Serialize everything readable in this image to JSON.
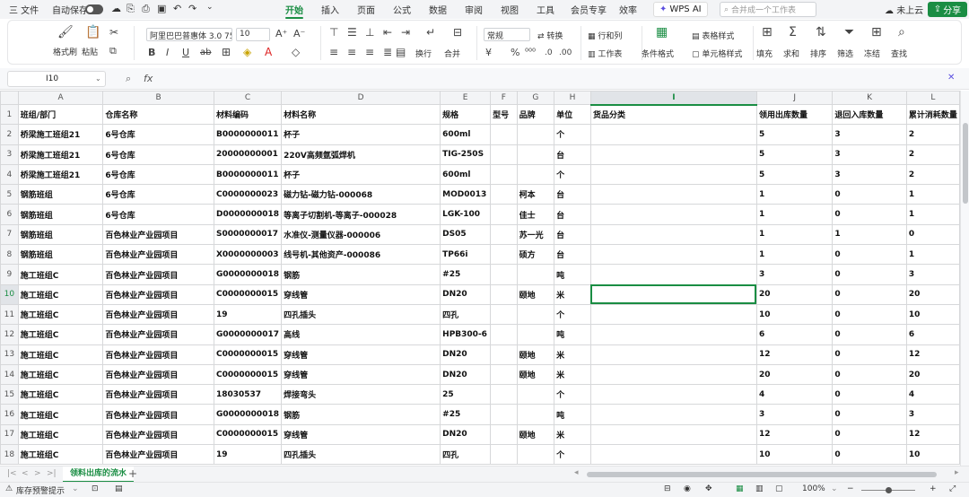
{
  "menubar": {
    "file_menu": "三 文件",
    "autosave_label": "自动保存",
    "tabs": [
      "开始",
      "插入",
      "页面",
      "公式",
      "数据",
      "审阅",
      "视图",
      "工具",
      "会员专享",
      "效率"
    ],
    "active_tab": "开始",
    "wps_ai": "WPS AI",
    "search_placeholder": "合并成一个工作表",
    "cloud_status": "未上云",
    "share_label": "分享"
  },
  "ribbon": {
    "format_painter": "格式刷",
    "paste": "粘贴",
    "font_name": "阿里巴巴普惠体 3.0 75",
    "font_size": "10",
    "wrap_text": "换行",
    "merge": "合并",
    "number_format": "常规",
    "convert": "转换",
    "rows_cols": "行和列",
    "worksheet": "工作表",
    "conditional_format": "条件格式",
    "table_style": "表格样式",
    "cell_style": "单元格样式",
    "fill": "填充",
    "sum": "求和",
    "sort": "排序",
    "filter": "筛选",
    "freeze": "冻结",
    "find": "查找"
  },
  "formula_bar": {
    "cell_ref": "I10",
    "fx": "fx",
    "content": ""
  },
  "columns": [
    "A",
    "B",
    "C",
    "D",
    "E",
    "F",
    "G",
    "H",
    "I",
    "J",
    "K",
    "L"
  ],
  "selected_column": "I",
  "selected_row": "10",
  "rows": [
    {
      "n": "1",
      "cells": [
        "班组/部门",
        "仓库名称",
        "材料编码",
        "材料名称",
        "规格",
        "型号",
        "品牌",
        "单位",
        "货品分类",
        "领用出库数量",
        "退回入库数量",
        "累计消耗数量"
      ]
    },
    {
      "n": "2",
      "cells": [
        "桥梁施工班组21",
        "6号仓库",
        "B0000000011",
        "杯子",
        "600ml",
        "",
        "",
        "个",
        "",
        "5",
        "3",
        "2"
      ]
    },
    {
      "n": "3",
      "cells": [
        "桥梁施工班组21",
        "6号仓库",
        "20000000001",
        "220V高频氩弧焊机",
        "TIG-250S",
        "",
        "",
        "台",
        "",
        "5",
        "3",
        "2"
      ]
    },
    {
      "n": "4",
      "cells": [
        "桥梁施工班组21",
        "6号仓库",
        "B0000000011",
        "杯子",
        "600ml",
        "",
        "",
        "个",
        "",
        "5",
        "3",
        "2"
      ]
    },
    {
      "n": "5",
      "cells": [
        "钢筋班组",
        "6号仓库",
        "C0000000023",
        "磁力钻-磁力钻-000068",
        "MOD0013",
        "",
        "柯本",
        "台",
        "",
        "1",
        "0",
        "1"
      ]
    },
    {
      "n": "6",
      "cells": [
        "钢筋班组",
        "6号仓库",
        "D0000000018",
        "等离子切割机-等离子-000028",
        "LGK-100",
        "",
        "佳士",
        "台",
        "",
        "1",
        "0",
        "1"
      ]
    },
    {
      "n": "7",
      "cells": [
        "钢筋班组",
        "百色林业产业园项目",
        "S0000000017",
        "水准仪-测量仪器-000006",
        "DS05",
        "",
        "苏一光",
        "台",
        "",
        "1",
        "1",
        "0"
      ]
    },
    {
      "n": "8",
      "cells": [
        "钢筋班组",
        "百色林业产业园项目",
        "X0000000003",
        "线号机-其他资产-000086",
        "TP66i",
        "",
        "硕方",
        "台",
        "",
        "1",
        "0",
        "1"
      ]
    },
    {
      "n": "9",
      "cells": [
        "施工班组C",
        "百色林业产业园项目",
        "G0000000018",
        "钢筋",
        "#25",
        "",
        "",
        "吨",
        "",
        "3",
        "0",
        "3"
      ]
    },
    {
      "n": "10",
      "cells": [
        "施工班组C",
        "百色林业产业园项目",
        "C0000000015",
        "穿线管",
        "DN20",
        "",
        "颐地",
        "米",
        "",
        "20",
        "0",
        "20"
      ]
    },
    {
      "n": "11",
      "cells": [
        "施工班组C",
        "百色林业产业园项目",
        "19",
        "四孔插头",
        "四孔",
        "",
        "",
        "个",
        "",
        "10",
        "0",
        "10"
      ]
    },
    {
      "n": "12",
      "cells": [
        "施工班组C",
        "百色林业产业园项目",
        "G0000000017",
        "高线",
        "HPB300-6",
        "",
        "",
        "吨",
        "",
        "6",
        "0",
        "6"
      ]
    },
    {
      "n": "13",
      "cells": [
        "施工班组C",
        "百色林业产业园项目",
        "C0000000015",
        "穿线管",
        "DN20",
        "",
        "颐地",
        "米",
        "",
        "12",
        "0",
        "12"
      ]
    },
    {
      "n": "14",
      "cells": [
        "施工班组C",
        "百色林业产业园项目",
        "C0000000015",
        "穿线管",
        "DN20",
        "",
        "颐地",
        "米",
        "",
        "20",
        "0",
        "20"
      ]
    },
    {
      "n": "15",
      "cells": [
        "施工班组C",
        "百色林业产业园项目",
        "18030537",
        "焊接弯头",
        "25",
        "",
        "",
        "个",
        "",
        "4",
        "0",
        "4"
      ]
    },
    {
      "n": "16",
      "cells": [
        "施工班组C",
        "百色林业产业园项目",
        "G0000000018",
        "钢筋",
        "#25",
        "",
        "",
        "吨",
        "",
        "3",
        "0",
        "3"
      ]
    },
    {
      "n": "17",
      "cells": [
        "施工班组C",
        "百色林业产业园项目",
        "C0000000015",
        "穿线管",
        "DN20",
        "",
        "颐地",
        "米",
        "",
        "12",
        "0",
        "12"
      ]
    },
    {
      "n": "18",
      "cells": [
        "施工班组C",
        "百色林业产业园项目",
        "19",
        "四孔插头",
        "四孔",
        "",
        "",
        "个",
        "",
        "10",
        "0",
        "10"
      ]
    }
  ],
  "sheet_tabs": [
    "领料出库的流水"
  ],
  "statusbar": {
    "left_item": "库存预警提示",
    "zoom": "100%"
  },
  "colors": {
    "accent": "#1a8d43",
    "header_bg": "#f3f4f6",
    "grid_line": "#d7d8da"
  }
}
